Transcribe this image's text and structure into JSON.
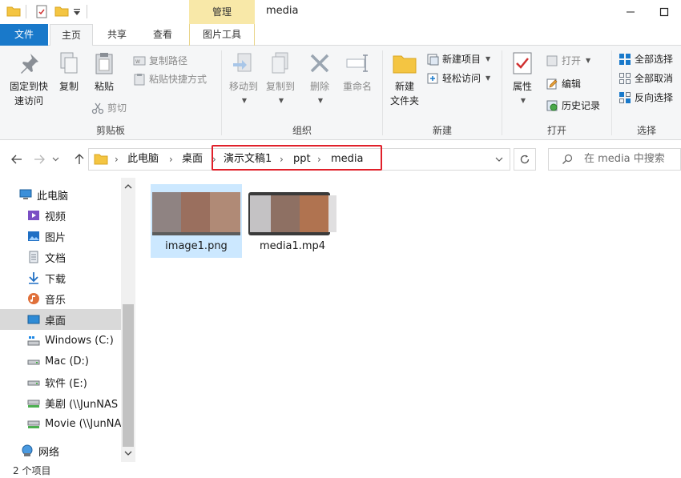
{
  "window": {
    "title": "media",
    "manage_tab": "管理"
  },
  "ribbon_tabs": {
    "file": "文件",
    "home": "主页",
    "share": "共享",
    "view": "查看",
    "picture_tools": "图片工具"
  },
  "clipboard": {
    "pin_line1": "固定到快",
    "pin_line2": "速访问",
    "copy": "复制",
    "paste": "粘贴",
    "copy_path": "复制路径",
    "paste_shortcut": "粘贴快捷方式",
    "cut": "剪切",
    "label": "剪贴板"
  },
  "organize": {
    "move_to": "移动到",
    "copy_to": "复制到",
    "delete": "删除",
    "rename": "重命名",
    "label": "组织"
  },
  "new_group": {
    "new_folder_line1": "新建",
    "new_folder_line2": "文件夹",
    "new_item": "新建项目",
    "easy_access": "轻松访问",
    "label": "新建"
  },
  "open_group": {
    "properties": "属性",
    "open": "打开",
    "edit": "编辑",
    "history": "历史记录",
    "label": "打开"
  },
  "select_group": {
    "select_all": "全部选择",
    "select_none": "全部取消",
    "invert": "反向选择",
    "label": "选择"
  },
  "address": {
    "crumbs": [
      "此电脑",
      "桌面",
      "演示文稿1",
      "ppt",
      "media"
    ],
    "search_placeholder": "在 media 中搜索"
  },
  "nav": {
    "items": [
      {
        "label": "此电脑",
        "icon": "computer-icon"
      },
      {
        "label": "视频",
        "icon": "video-folder-icon"
      },
      {
        "label": "图片",
        "icon": "pictures-folder-icon"
      },
      {
        "label": "文档",
        "icon": "documents-folder-icon"
      },
      {
        "label": "下载",
        "icon": "download-icon"
      },
      {
        "label": "音乐",
        "icon": "music-icon"
      },
      {
        "label": "桌面",
        "icon": "desktop-icon"
      },
      {
        "label": "Windows (C:)",
        "icon": "drive-windows-icon"
      },
      {
        "label": "Mac (D:)",
        "icon": "drive-icon"
      },
      {
        "label": "软件 (E:)",
        "icon": "drive-icon"
      },
      {
        "label": "美剧 (\\\\JunNAS",
        "icon": "network-drive-icon"
      },
      {
        "label": "Movie (\\\\JunNA",
        "icon": "network-drive-icon"
      },
      {
        "label": "网络",
        "icon": "network-icon"
      }
    ]
  },
  "files": [
    {
      "name": "image1.png"
    },
    {
      "name": "media1.mp4"
    }
  ],
  "status": {
    "item_count": "2 个项目"
  }
}
